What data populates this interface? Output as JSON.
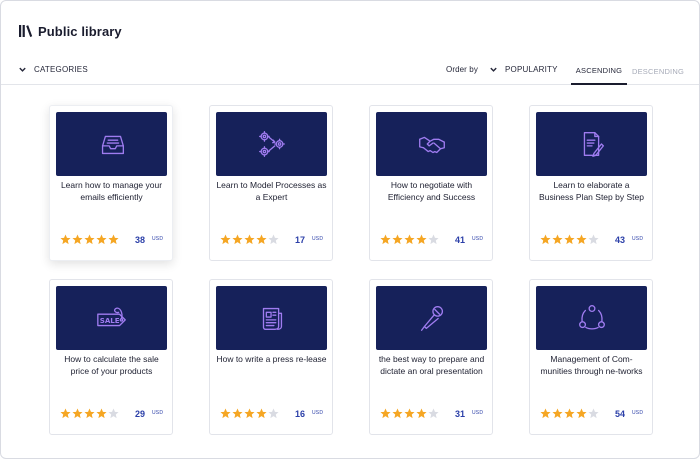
{
  "header": {
    "title": "Public library",
    "logo_icon": "library-books-icon"
  },
  "filters": {
    "categories_label": "CATEGORIES",
    "order_by_label": "Order by",
    "order_value": "POPULARITY",
    "tabs": [
      {
        "label": "ASCENDING",
        "active": true
      },
      {
        "label": "DESCENDING",
        "active": false
      }
    ]
  },
  "colors": {
    "thumb_bg": "#16215a",
    "icon_stroke": "#9f7cf0",
    "star_filled": "#f5a623",
    "star_empty": "#d9dbe2",
    "price": "#2b3fa8"
  },
  "courses": [
    {
      "title": "Learn how to manage your emails efficiently",
      "icon": "inbox-tray-icon",
      "rating": 5,
      "price": "38",
      "currency": "USD"
    },
    {
      "title": "Learn to Model Processes as a Expert",
      "icon": "gears-process-icon",
      "rating": 4,
      "price": "17",
      "currency": "USD"
    },
    {
      "title": "How to negotiate with Efficiency and Success",
      "icon": "handshake-icon",
      "rating": 4,
      "price": "41",
      "currency": "USD"
    },
    {
      "title": "Learn to elaborate a Business Plan Step by Step",
      "icon": "document-pen-icon",
      "rating": 4,
      "price": "43",
      "currency": "USD"
    },
    {
      "title": "How to calculate the sale price of your products",
      "icon": "sale-tag-icon",
      "rating": 4,
      "price": "29",
      "currency": "USD"
    },
    {
      "title": "How to write a press re-lease",
      "icon": "newspaper-icon",
      "rating": 4,
      "price": "16",
      "currency": "USD"
    },
    {
      "title": "the best way to prepare and dictate an oral presentation",
      "icon": "microphone-icon",
      "rating": 4,
      "price": "31",
      "currency": "USD"
    },
    {
      "title": "Management of Com-munities through ne-tworks",
      "icon": "community-network-icon",
      "rating": 4,
      "price": "54",
      "currency": "USD"
    }
  ]
}
